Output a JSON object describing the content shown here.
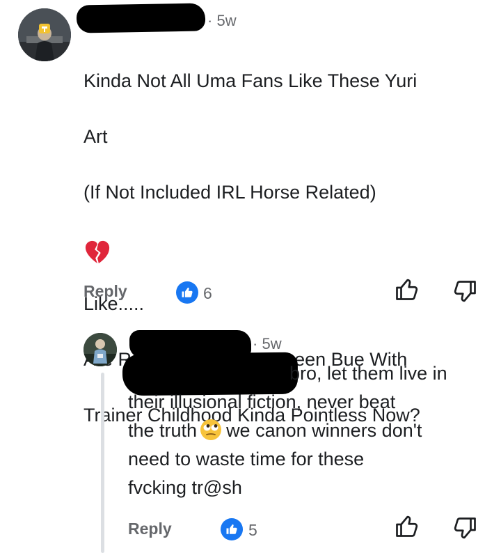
{
  "comment": {
    "time": "5w",
    "lines": [
      "Kinda Not All Uma Fans Like These Yuri",
      "Art",
      "(If Not Included IRL Horse Related)",
      "",
      "Like.....",
      "Are Romance Story Between Bue With",
      "Trainer Childhood Kinda Pointless Now?"
    ],
    "emoji_icon": "broken-heart-icon",
    "reply_label": "Reply",
    "like_count": "6",
    "accent": "#1877f2"
  },
  "reply": {
    "time": "5w",
    "text_before_emoji_line1": "bro, let them live in",
    "line2": "their illusional fiction, never beat",
    "line3_a": "the truth",
    "line3_b": "we canon winners don't",
    "line4": "need to waste time for these",
    "line5": "fvcking tr@sh",
    "emoji_icon": "face-with-rolling-eyes-icon",
    "reply_label": "Reply",
    "like_count": "5"
  }
}
